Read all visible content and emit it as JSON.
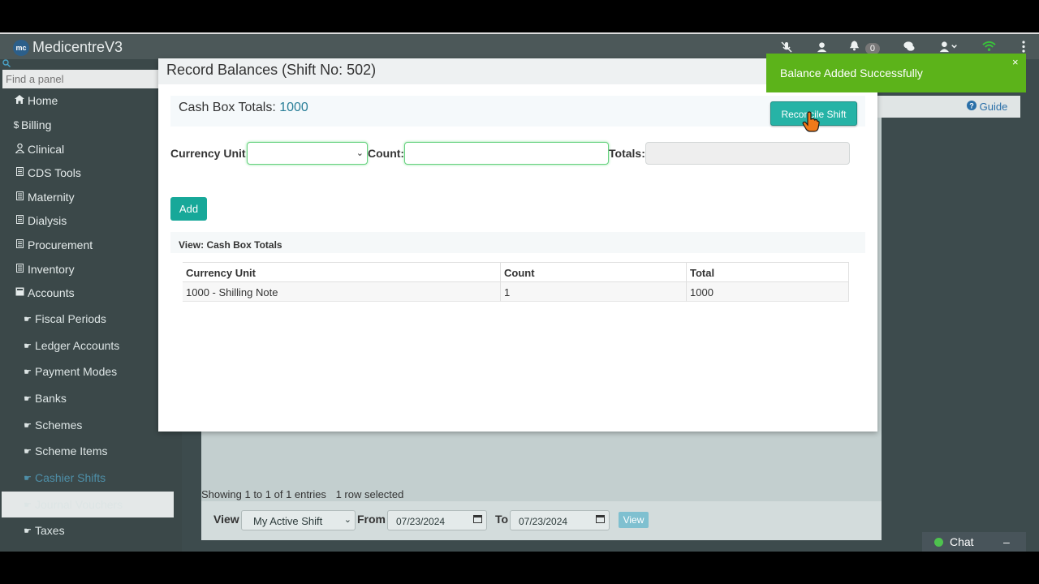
{
  "app": {
    "title": "MedicentreV3",
    "logo_text": "mc"
  },
  "topbar": {
    "notifications_count": "0"
  },
  "sidebar": {
    "search_placeholder": "Find a panel",
    "items": [
      {
        "label": "Home",
        "icon": "home-icon"
      },
      {
        "label": "Billing",
        "icon": "dollar-icon"
      },
      {
        "label": "Clinical",
        "icon": "user-md-icon"
      },
      {
        "label": "CDS Tools",
        "icon": "book-icon"
      },
      {
        "label": "Maternity",
        "icon": "book-icon"
      },
      {
        "label": "Dialysis",
        "icon": "book-icon"
      },
      {
        "label": "Procurement",
        "icon": "book-icon"
      },
      {
        "label": "Inventory",
        "icon": "book-icon"
      },
      {
        "label": "Accounts",
        "icon": "folder-icon"
      }
    ],
    "sub_items": [
      {
        "label": "Fiscal Periods"
      },
      {
        "label": "Ledger Accounts"
      },
      {
        "label": "Payment Modes"
      },
      {
        "label": "Banks"
      },
      {
        "label": "Schemes"
      },
      {
        "label": "Scheme Items"
      },
      {
        "label": "Cashier Shifts",
        "active": true
      },
      {
        "label": "Journal Vouchers"
      },
      {
        "label": "Taxes"
      }
    ]
  },
  "guide": {
    "label": "Guide"
  },
  "background": {
    "entries": "Showing 1 to 1 of 1 entries",
    "selected": "1 row selected",
    "filter": {
      "view_label": "View",
      "shift_value": "My Active Shift",
      "from_label": "From",
      "from_date": "07/23/2024",
      "to_label": "To",
      "to_date": "07/23/2024",
      "view_button": "View"
    }
  },
  "modal": {
    "title": "Record Balances (Shift No: 502)",
    "cashbox_label": "Cash Box Totals:",
    "cashbox_value": "1000",
    "reconcile_button": "Reconcile Shift",
    "form": {
      "currency_label": "Currency Unit:",
      "count_label": "Count:",
      "totals_label": "Totals:",
      "add_button": "Add"
    },
    "view_title": "View: Cash Box Totals",
    "table": {
      "headers": [
        "Currency Unit",
        "Count",
        "Total"
      ],
      "rows": [
        [
          "1000 - Shilling Note",
          "1",
          "1000"
        ]
      ]
    }
  },
  "toast": {
    "message": "Balance Added Successfully",
    "close": "×"
  },
  "chat": {
    "label": "Chat",
    "minimize": "–"
  }
}
